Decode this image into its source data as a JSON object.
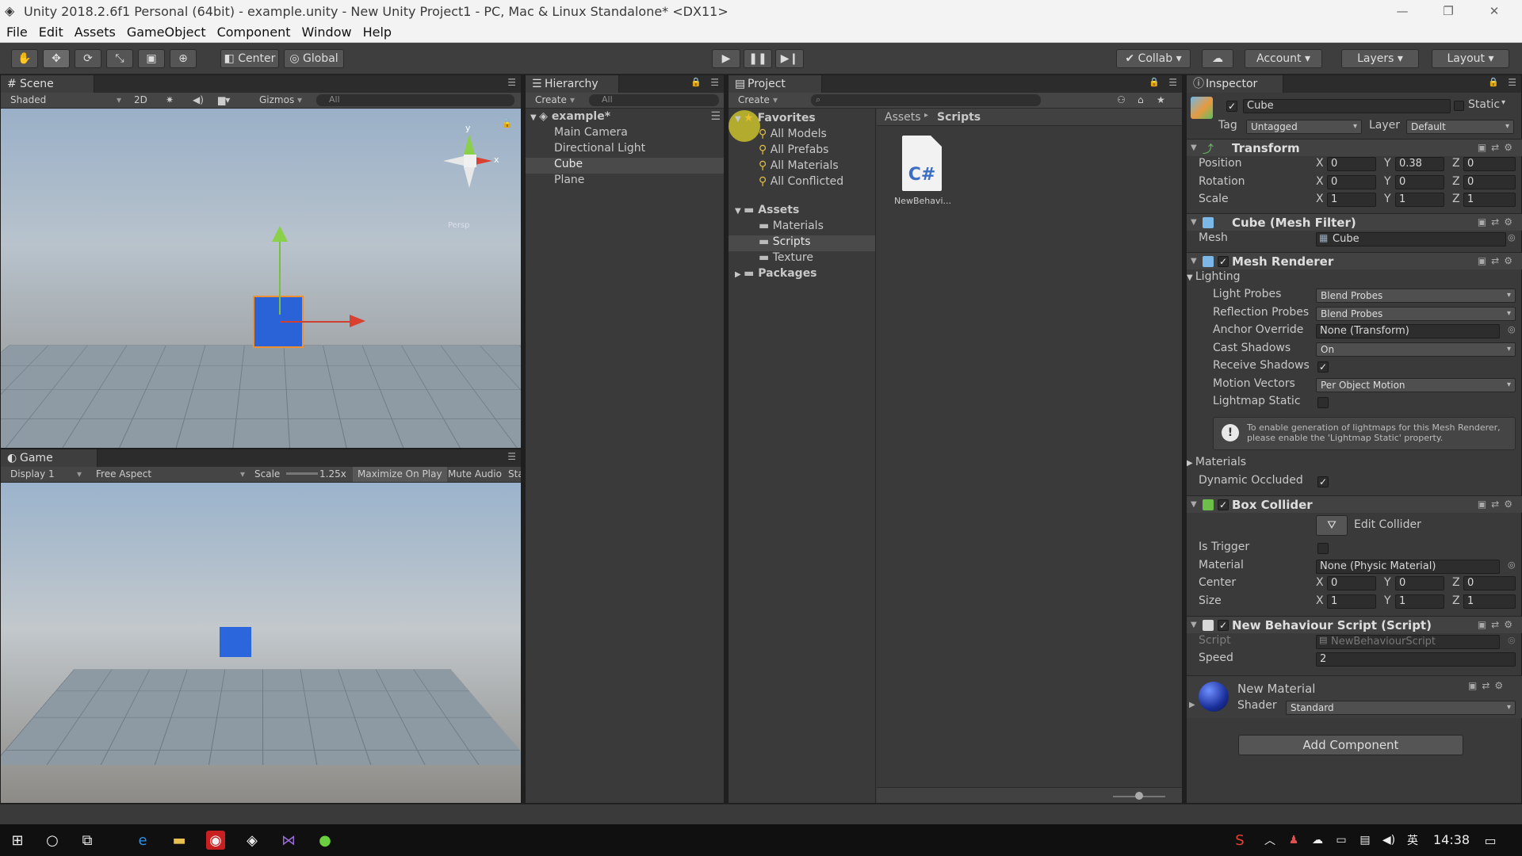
{
  "window": {
    "title": "Unity 2018.2.6f1 Personal (64bit) - example.unity - New Unity Project1 - PC, Mac & Linux Standalone* <DX11>",
    "minimize": "—",
    "restore": "❐",
    "close": "✕"
  },
  "menu": [
    "File",
    "Edit",
    "Assets",
    "GameObject",
    "Component",
    "Window",
    "Help"
  ],
  "toolbar": {
    "pivot": "Center",
    "space": "Global",
    "collab": "Collab",
    "account": "Account",
    "layers": "Layers",
    "layout": "Layout"
  },
  "scene": {
    "tab": "Scene",
    "shading": "Shaded",
    "mode2d": "2D",
    "gizmos": "Gizmos",
    "search": "All",
    "axis_y": "y",
    "axis_x": "x",
    "persp": "Persp"
  },
  "game": {
    "tab": "Game",
    "display": "Display 1",
    "aspect": "Free Aspect",
    "scale_label": "Scale",
    "scale_value": "1.25x",
    "maximize": "Maximize On Play",
    "mute": "Mute Audio",
    "stats": "Stats"
  },
  "hierarchy": {
    "tab": "Hierarchy",
    "create": "Create",
    "search": "All",
    "scene": "example*",
    "items": [
      "Main Camera",
      "Directional Light",
      "Cube",
      "Plane"
    ],
    "selected": "Cube"
  },
  "project": {
    "tab": "Project",
    "create": "Create",
    "favorites": "Favorites",
    "fav_items": [
      "All Models",
      "All Prefabs",
      "All Materials",
      "All Conflicted"
    ],
    "assets": "Assets",
    "asset_items": [
      "Materials",
      "Scripts",
      "Texture"
    ],
    "packages": "Packages",
    "breadcrumb_root": "Assets",
    "breadcrumb_sep": "▸",
    "breadcrumb_leaf": "Scripts",
    "file_icon": "C#",
    "file_name": "NewBehavi..."
  },
  "inspector": {
    "tab": "Inspector",
    "name": "Cube",
    "static": "Static",
    "tag_label": "Tag",
    "tag": "Untagged",
    "layer_label": "Layer",
    "layer": "Default",
    "transform": {
      "title": "Transform",
      "rows": [
        {
          "label": "Position",
          "x": "0",
          "y": "0.38",
          "z": "0"
        },
        {
          "label": "Rotation",
          "x": "0",
          "y": "0",
          "z": "0"
        },
        {
          "label": "Scale",
          "x": "1",
          "y": "1",
          "z": "1"
        }
      ]
    },
    "axis": {
      "x": "X",
      "y": "Y",
      "z": "Z"
    },
    "meshfilter": {
      "title": "Cube (Mesh Filter)",
      "mesh_label": "Mesh",
      "mesh": "Cube"
    },
    "renderer": {
      "title": "Mesh Renderer",
      "lighting": "Lighting",
      "light_probes_label": "Light Probes",
      "light_probes": "Blend Probes",
      "reflection_label": "Reflection Probes",
      "reflection": "Blend Probes",
      "anchor_label": "Anchor Override",
      "anchor": "None (Transform)",
      "cast_label": "Cast Shadows",
      "cast": "On",
      "receive_label": "Receive Shadows",
      "motion_label": "Motion Vectors",
      "motion": "Per Object Motion",
      "lightmap_label": "Lightmap Static",
      "info": "To enable generation of lightmaps for this Mesh Renderer, please enable the 'Lightmap Static' property.",
      "materials": "Materials",
      "occluded_label": "Dynamic Occluded"
    },
    "collider": {
      "title": "Box Collider",
      "edit": "Edit Collider",
      "trigger_label": "Is Trigger",
      "material_label": "Material",
      "material": "None (Physic Material)",
      "center_label": "Center",
      "center": {
        "x": "0",
        "y": "0",
        "z": "0"
      },
      "size_label": "Size",
      "size": {
        "x": "1",
        "y": "1",
        "z": "1"
      }
    },
    "script": {
      "title": "New Behaviour Script (Script)",
      "script_label": "Script",
      "script": "NewBehaviourScript",
      "speed_label": "Speed",
      "speed": "2"
    },
    "material": {
      "title": "New Material",
      "shader_label": "Shader",
      "shader": "Standard"
    },
    "add_component": "Add Component"
  },
  "taskbar": {
    "time": "14:38",
    "ime": "英"
  }
}
